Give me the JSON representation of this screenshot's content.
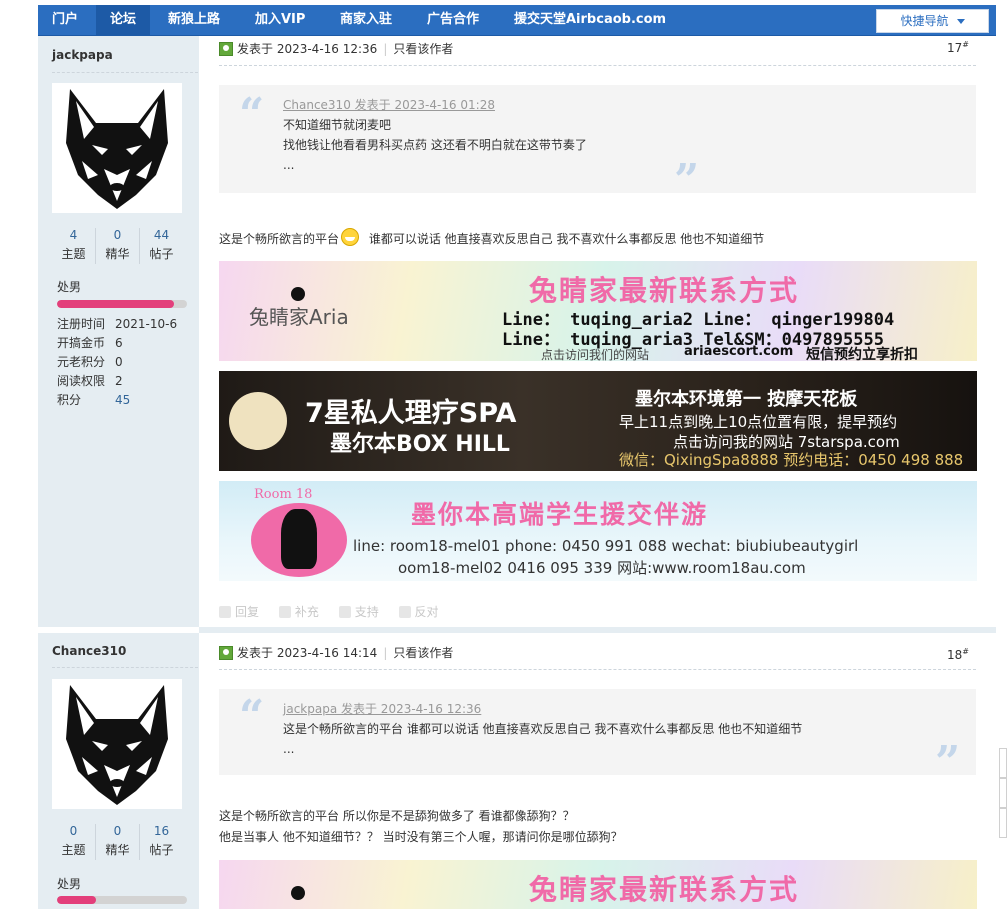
{
  "nav": {
    "items": [
      "门户",
      "论坛",
      "新狼上路",
      "加入VIP",
      "商家入驻",
      "广告合作",
      "援交天堂Airbcaob.com"
    ],
    "active_index": 1,
    "quick_nav": "快捷导航"
  },
  "posts": [
    {
      "author": {
        "name": "jackpapa",
        "stats": [
          {
            "num": "4",
            "label": "主题"
          },
          {
            "num": "0",
            "label": "精华"
          },
          {
            "num": "44",
            "label": "帖子"
          }
        ],
        "level": "处男",
        "level_progress": 0.9,
        "info": [
          {
            "key": "注册时间",
            "value": "2021-10-6"
          },
          {
            "key": "开搞金币",
            "value": "6"
          },
          {
            "key": "元老积分",
            "value": "0"
          },
          {
            "key": "阅读权限",
            "value": "2"
          },
          {
            "key": "积分",
            "value": "45"
          }
        ]
      },
      "posted": "发表于 2023-4-16 12:36",
      "only_author": "只看该作者",
      "floor": "17",
      "quote": {
        "header": "Chance310 发表于 2023-4-16 01:28",
        "lines": [
          "不知道细节就闭麦吧",
          "找他钱让他看看男科买点药 这还看不明白就在这带节奏了",
          "..."
        ]
      },
      "body": [
        "这是个畅所欲言的平台",
        "谁都可以说话 他直接喜欢反思自己 我不喜欢什么事都反思 他也不知道细节"
      ]
    },
    {
      "author": {
        "name": "Chance310",
        "stats": [
          {
            "num": "0",
            "label": "主题"
          },
          {
            "num": "0",
            "label": "精华"
          },
          {
            "num": "16",
            "label": "帖子"
          }
        ],
        "level": "处男",
        "level_progress": 0.3
      },
      "posted": "发表于 2023-4-16 14:14",
      "only_author": "只看该作者",
      "floor": "18",
      "quote": {
        "header": "jackpapa 发表于 2023-4-16 12:36",
        "lines": [
          "这是个畅所欲言的平台  谁都可以说话 他直接喜欢反思自己 我不喜欢什么事都反思 他也不知道细节",
          "..."
        ]
      },
      "body": [
        "这是个畅所欲言的平台 所以你是不是舔狗做多了 看谁都像舔狗？？",
        "他是当事人 他不知道细节？？ 当时没有第三个人喔，那请问你是哪位舔狗？"
      ]
    }
  ],
  "actions": [
    "回复",
    "补充",
    "支持",
    "反对"
  ],
  "banners": {
    "aria": {
      "title": "兔睛家最新联系方式",
      "logo": "兔睛家Aria",
      "line1": "Line：  tuqing_aria2   Line：    qinger199804",
      "line2": "Line：  tuqing_aria3   Tel&SM：0497895555",
      "visit": "点击访问我们的网站",
      "site": "ariaescort.com",
      "promo": "短信预约立享折扣"
    },
    "spa": {
      "title": "7星私人理疗SPA",
      "subtitle": "墨尔本BOX HILL",
      "right1": "墨尔本环境第一   按摩天花板",
      "right2": "早上11点到晚上10点位置有限，提早预约",
      "right3": "点击访问我的网站 7starspa.com",
      "right4": "微信：QixingSpa8888  预约电话：0450 498 888"
    },
    "room18": {
      "logo": "Room 18",
      "title": "墨你本高端学生援交伴游",
      "line1": "line: room18-mel01   phone: 0450 991 088    wechat: biubiubeautygirl",
      "line2": "oom18-mel02              0416 095 339    网站:www.room18au.com"
    },
    "aria_repeat_title": "兔睛家最新联系方式"
  },
  "colors": {
    "nav_bg": "#2b6ec0",
    "sidebar_bg": "#e5edf2",
    "link": "#336699",
    "pink": "#f06aa8"
  }
}
